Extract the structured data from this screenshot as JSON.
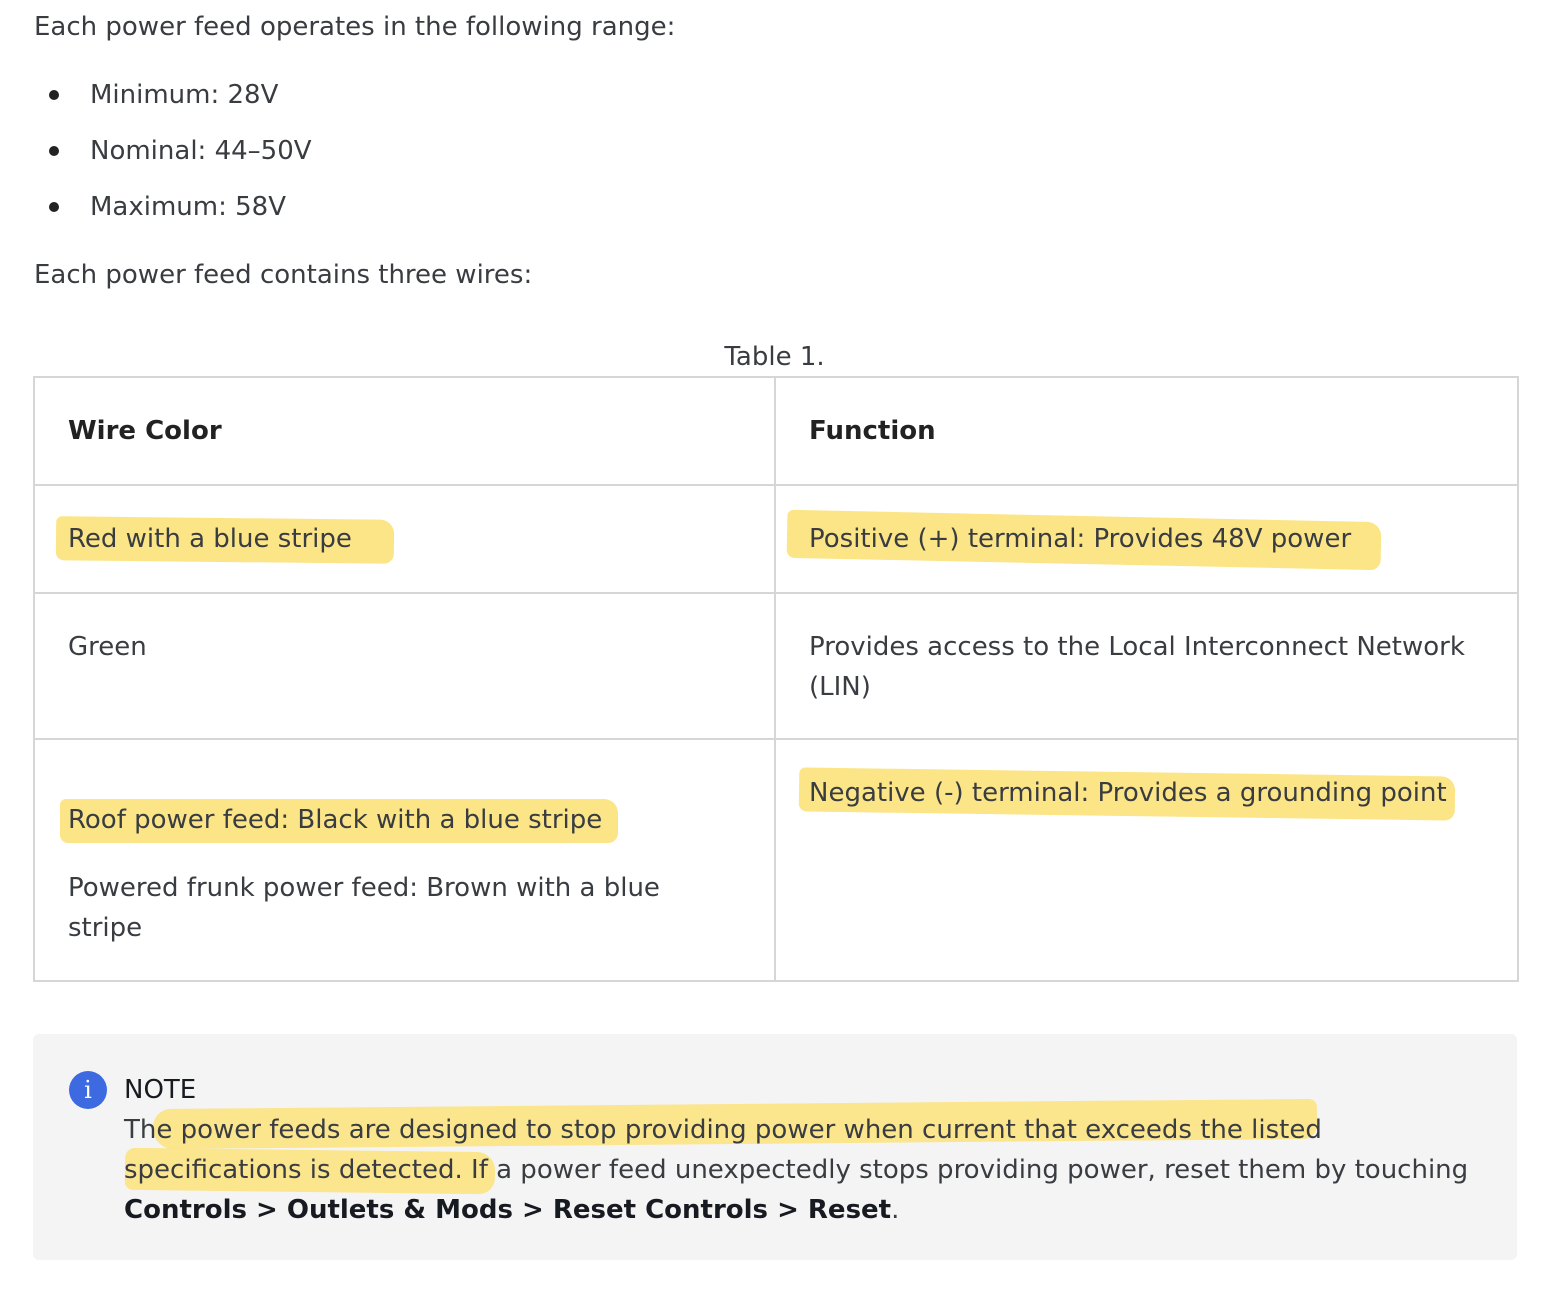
{
  "intro": "Each power feed operates in the following range:",
  "range": [
    "Minimum: 28V",
    "Nominal: 44–50V",
    "Maximum: 58V"
  ],
  "wires_intro": "Each power feed contains three wires:",
  "table": {
    "caption": "Table 1.",
    "headers": [
      "Wire Color",
      "Function"
    ],
    "rows": [
      {
        "color": "Red with a blue stripe",
        "function": "Positive (+) terminal: Provides 48V power"
      },
      {
        "color": "Green",
        "function": "Provides access to the Local Interconnect Network (LIN)"
      },
      {
        "color_roof": "Roof power feed: Black with a blue stripe",
        "color_frunk": "Powered frunk power feed: Brown with a blue stripe",
        "function": "Negative (-) terminal: Provides a grounding point"
      }
    ]
  },
  "note": {
    "title": "NOTE",
    "text": "The power feeds are designed to stop providing power when current that exceeds the listed specifications is detected. If a  power feed unexpectedly stops providing power, reset them by touching",
    "path": "Controls > Outlets & Mods > Reset Controls > Reset",
    "suffix": "."
  },
  "colors": {
    "highlight": "#fbe27a",
    "info_icon": "#3e6ae1",
    "note_bg": "#f4f4f4",
    "table_border": "#d6d6d6"
  },
  "icons": {
    "note_icon": "info-icon"
  }
}
